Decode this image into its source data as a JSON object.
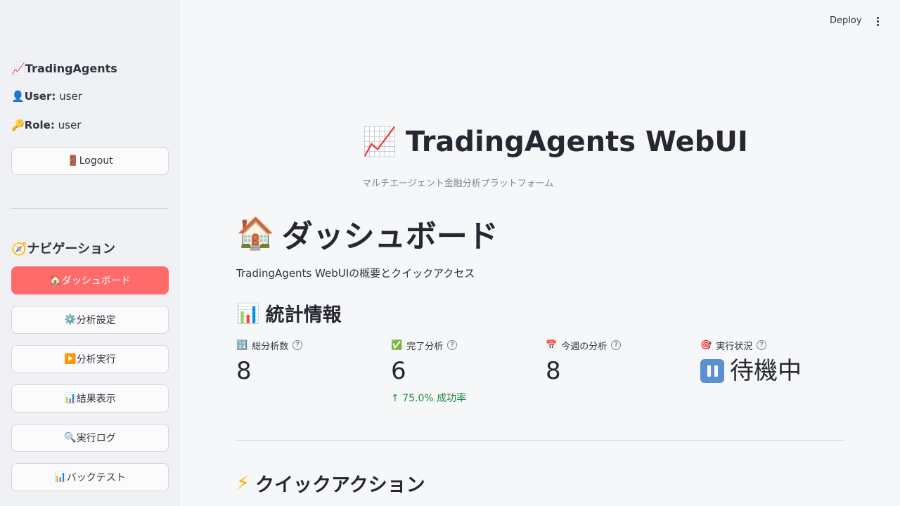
{
  "sidebar": {
    "app_title_icon": "chart-increasing-icon",
    "app_title": "TradingAgents",
    "user_label": "User:",
    "user_value": "user",
    "role_label": "Role:",
    "role_value": "user",
    "logout_label": "Logout",
    "nav_title": "ナビゲーション",
    "nav_items": [
      {
        "icon": "house-icon",
        "emoji": "🏠",
        "label": "ダッシュボード",
        "active": true
      },
      {
        "icon": "gear-icon",
        "emoji": "⚙️",
        "label": "分析設定",
        "active": false
      },
      {
        "icon": "play-icon",
        "emoji": "▶️",
        "label": "分析実行",
        "active": false
      },
      {
        "icon": "bar-chart-icon",
        "emoji": "📊",
        "label": "結果表示",
        "active": false
      },
      {
        "icon": "magnifier-icon",
        "emoji": "🔍",
        "label": "実行ログ",
        "active": false
      },
      {
        "icon": "bar-chart-icon",
        "emoji": "📊",
        "label": "バックテスト",
        "active": false
      }
    ]
  },
  "toolbar": {
    "deploy_label": "Deploy"
  },
  "header": {
    "title": "TradingAgents WebUI",
    "subtitle": "マルチエージェント金融分析プラットフォーム"
  },
  "page": {
    "title": "ダッシュボード",
    "description": "TradingAgents WebUIの概要とクイックアクセス",
    "stats_title": "統計情報",
    "quick_title": "クイックアクション"
  },
  "metrics": [
    {
      "icon": "numbers-icon",
      "emoji": "🔢",
      "label": "総分析数",
      "value": "8"
    },
    {
      "icon": "check-mark-icon",
      "emoji": "✅",
      "label": "完了分析",
      "value": "6",
      "delta": "↑ 75.0% 成功率"
    },
    {
      "icon": "calendar-icon",
      "emoji": "📅",
      "label": "今週の分析",
      "value": "8"
    },
    {
      "icon": "target-icon",
      "emoji": "🎯",
      "label": "実行状況",
      "value": "待機中"
    }
  ],
  "colors": {
    "primary": "#ff6b6b",
    "delta_positive": "#1d8a3a",
    "sidebar_bg": "#eff1f5"
  }
}
